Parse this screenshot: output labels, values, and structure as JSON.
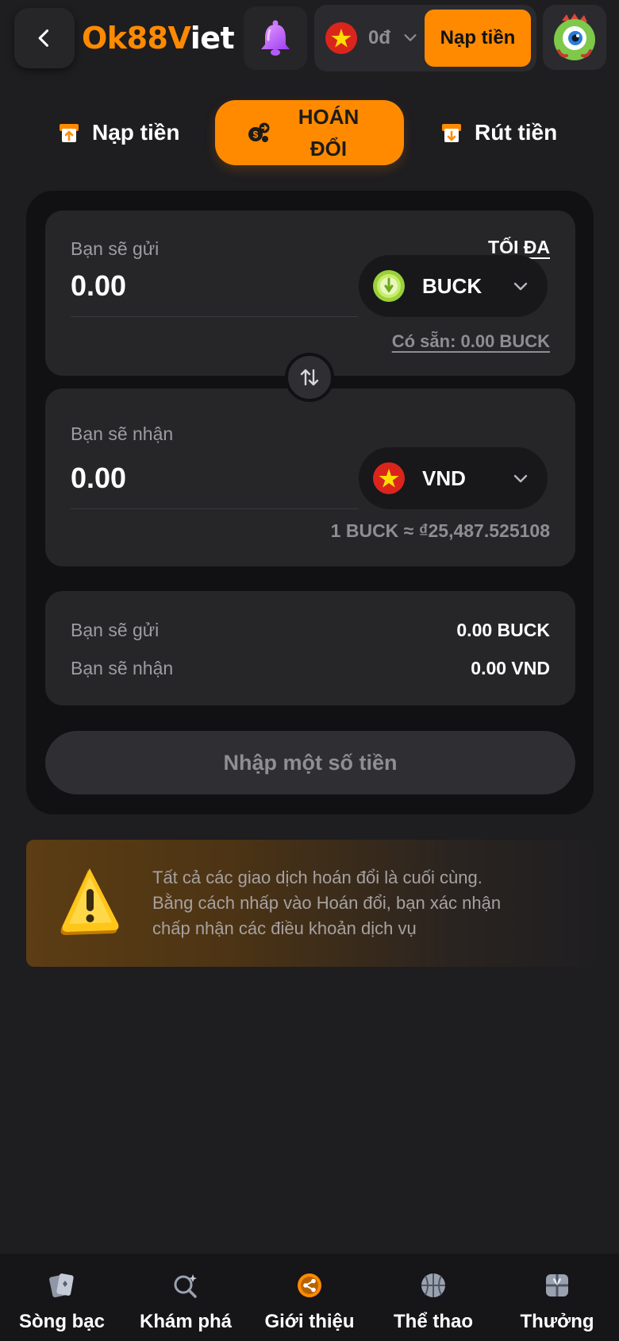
{
  "header": {
    "logo_ok": "Ok88",
    "logo_v": "V",
    "logo_end": "iet",
    "balance": "0đ",
    "deposit_label": "Nạp tiền"
  },
  "tabs": [
    {
      "label": "Nạp tiền",
      "icon": "deposit-icon"
    },
    {
      "label": "HOÁN ĐỔI",
      "icon": "exchange-icon",
      "active": true
    },
    {
      "label": "Rút tiền",
      "icon": "withdraw-icon"
    }
  ],
  "send": {
    "label": "Bạn sẽ gửi",
    "max_label": "TỐI ĐA",
    "amount_placeholder": "0.00",
    "currency": "BUCK",
    "available": "Có sẵn: 0.00 BUCK"
  },
  "receive": {
    "label": "Bạn sẽ nhận",
    "amount_placeholder": "0.00",
    "currency": "VND",
    "rate": "1 BUCK ≈ ₫25,487.525108"
  },
  "summary": {
    "send_label": "Bạn sẽ gửi",
    "send_value": "0.00 BUCK",
    "recv_label": "Bạn sẽ nhận",
    "recv_value": "0.00 VND"
  },
  "submit_label": "Nhập một số tiền",
  "warning": {
    "line1": "Tất cả các giao dịch hoán đổi là cuối cùng.",
    "line2": "Bằng cách nhấp vào Hoán đổi, bạn xác nhận",
    "line3": "chấp nhận các điều khoản dịch vụ"
  },
  "bottom_nav": [
    {
      "label": "Sòng bạc",
      "icon": "cards-icon"
    },
    {
      "label": "Khám phá",
      "icon": "explore-icon"
    },
    {
      "label": "Giới thiệu",
      "icon": "share-icon"
    },
    {
      "label": "Thể thao",
      "icon": "basketball-icon"
    },
    {
      "label": "Thưởng",
      "icon": "gift-icon"
    }
  ],
  "colors": {
    "accent": "#ff8a00",
    "background": "#1e1d20",
    "card": "#262528"
  }
}
